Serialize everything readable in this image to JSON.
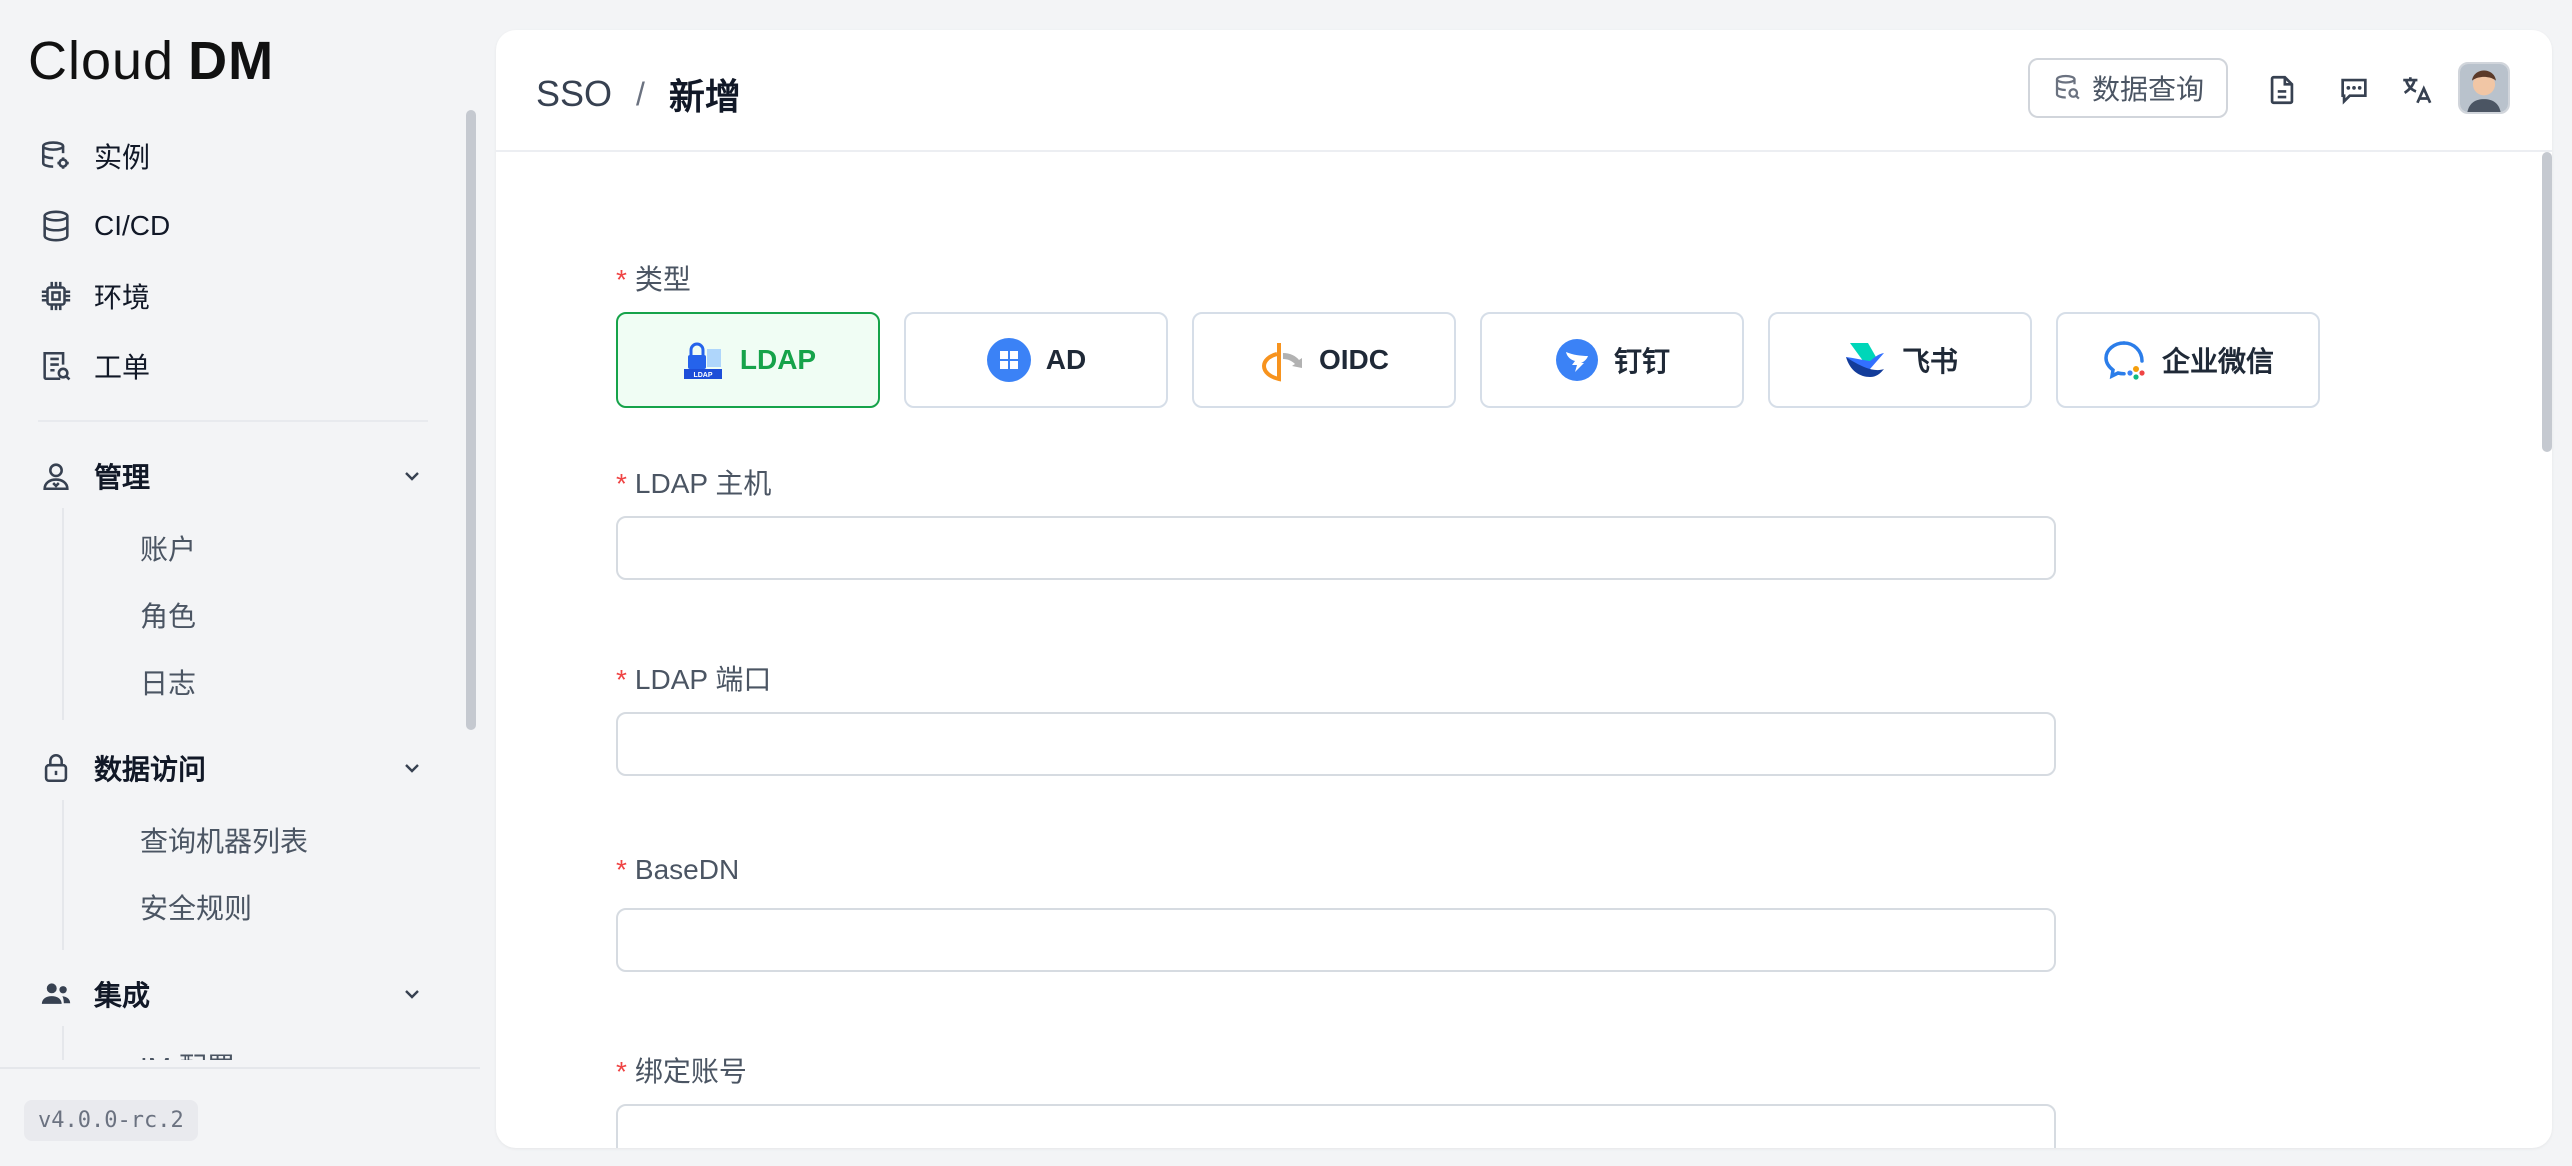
{
  "logo": {
    "text1": "Cloud",
    "text2": "DM"
  },
  "sidebar": {
    "items": [
      {
        "label": "实例"
      },
      {
        "label": "CI/CD"
      },
      {
        "label": "环境"
      },
      {
        "label": "工单"
      }
    ],
    "groups": [
      {
        "label": "管理",
        "children": [
          "账户",
          "角色",
          "日志"
        ]
      },
      {
        "label": "数据访问",
        "children": [
          "查询机器列表",
          "安全规则"
        ]
      },
      {
        "label": "集成",
        "children": [
          "IM 配置"
        ]
      }
    ],
    "version": "v4.0.0-rc.2"
  },
  "header": {
    "breadcrumb": [
      "SSO",
      "新增"
    ],
    "separator": "/",
    "query_button": "数据查询"
  },
  "form": {
    "required_mark": "*",
    "type_label": "类型",
    "types": [
      "LDAP",
      "AD",
      "OIDC",
      "钉钉",
      "飞书",
      "企业微信"
    ],
    "selected_type": "LDAP",
    "ldap_badge": "LDAP",
    "fields": [
      {
        "label": "LDAP 主机",
        "value": ""
      },
      {
        "label": "LDAP 端口",
        "value": ""
      },
      {
        "label": "BaseDN",
        "value": ""
      },
      {
        "label": "绑定账号",
        "value": ""
      }
    ]
  },
  "colors": {
    "accent": "#16a34a",
    "required": "#ef4444"
  },
  "icons": {
    "sidebar": [
      "database-settings-icon",
      "database-icon",
      "cpu-chip-icon",
      "ticket-edit-icon",
      "user-admin-icon",
      "lock-icon",
      "users-icon"
    ],
    "header": [
      "database-icon",
      "document-icon",
      "chat-icon",
      "translate-icon",
      "avatar"
    ]
  }
}
